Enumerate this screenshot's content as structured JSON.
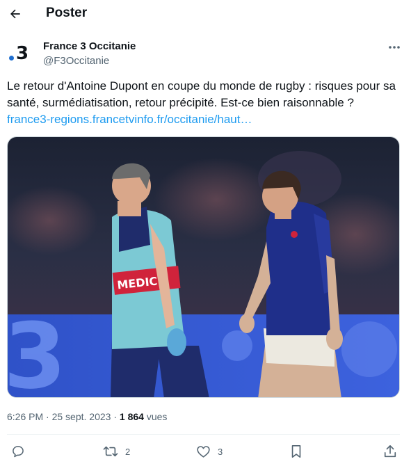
{
  "header": {
    "title": "Poster"
  },
  "author": {
    "display_name": "France 3 Occitanie",
    "handle": "@F3Occitanie",
    "avatar_digit": "3"
  },
  "tweet": {
    "text": "Le retour d'Antoine Dupont en coupe du monde de rugby : risques pour sa santé, surmédiatisation, retour précipité. Est-ce bien raisonnable ?",
    "link": "france3-regions.francetvinfo.fr/occitanie/haut…"
  },
  "media": {
    "bib_text": "MEDIC",
    "board_text": "3"
  },
  "meta": {
    "time": "6:26 PM",
    "separator": "·",
    "date": "25 sept. 2023",
    "views_count": "1 864",
    "views_label": "vues"
  },
  "actions": {
    "reply_count": "",
    "retweet_count": "2",
    "like_count": "3"
  },
  "colors": {
    "link": "#1d9bf0",
    "secondary_text": "#536471",
    "france3_dot": "#1f6fd0"
  },
  "icons": [
    "back-arrow-icon",
    "more-icon",
    "reply-icon",
    "retweet-icon",
    "like-icon",
    "bookmark-icon",
    "share-icon"
  ]
}
